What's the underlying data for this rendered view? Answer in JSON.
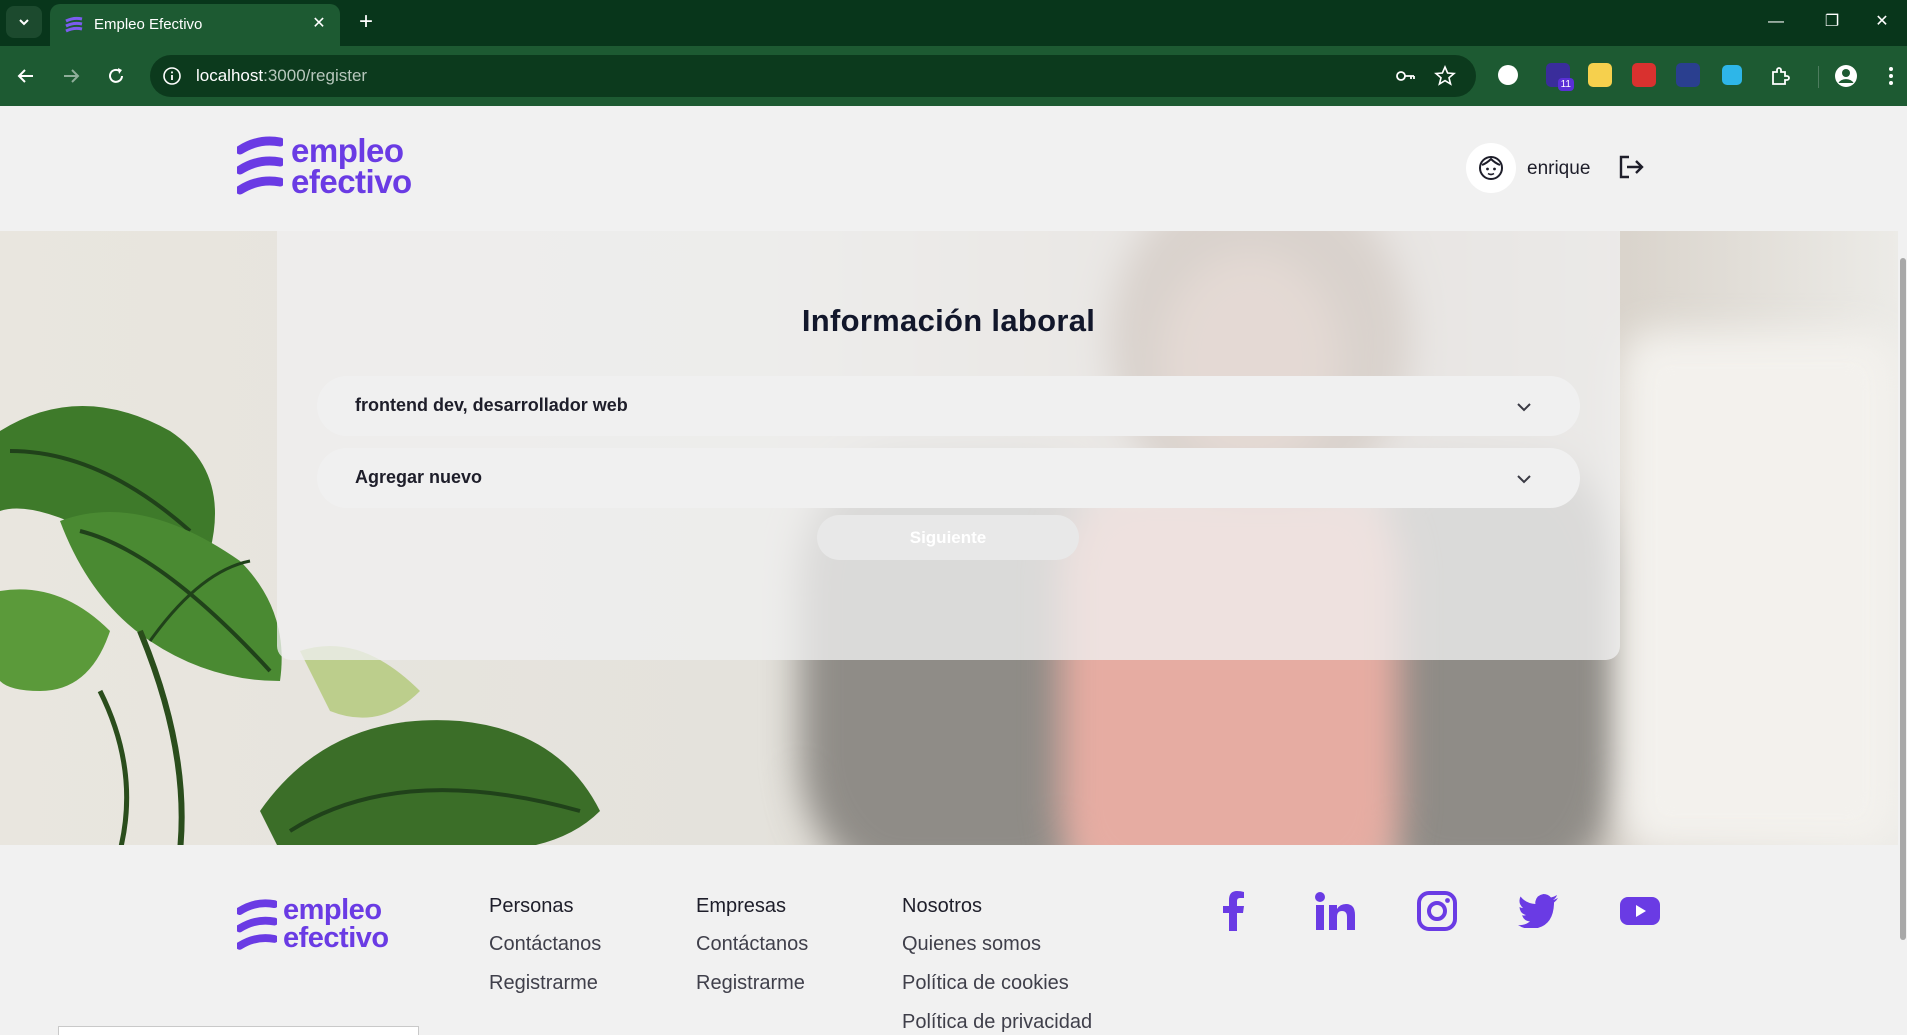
{
  "browser": {
    "tab_title": "Empleo Efectivo",
    "url_host": "localhost",
    "url_path": ":3000/register",
    "extension_badge": "11"
  },
  "header": {
    "logo_line1": "empleo",
    "logo_line2": "efectivo",
    "user_name": "enrique"
  },
  "form": {
    "title": "Información laboral",
    "fields": [
      {
        "value": "frontend dev, desarrollador web"
      },
      {
        "value": "Agregar nuevo"
      }
    ],
    "next_label": "Siguiente"
  },
  "footer": {
    "logo_line1": "empleo",
    "logo_line2": "efectivo",
    "columns": [
      {
        "heading": "Personas",
        "links": [
          "Contáctanos",
          "Registrarme"
        ]
      },
      {
        "heading": "Empresas",
        "links": [
          "Contáctanos",
          "Registrarme"
        ]
      },
      {
        "heading": "Nosotros",
        "links": [
          "Quienes somos",
          "Política de cookies",
          "Política de privacidad"
        ]
      }
    ],
    "social": [
      "facebook-icon",
      "linkedin-icon",
      "instagram-icon",
      "twitter-icon",
      "youtube-icon"
    ]
  },
  "colors": {
    "brand": "#6a3be4",
    "chrome_dark": "#08361b",
    "chrome_toolbar": "#1d5a32",
    "text_dark": "#12172b"
  }
}
